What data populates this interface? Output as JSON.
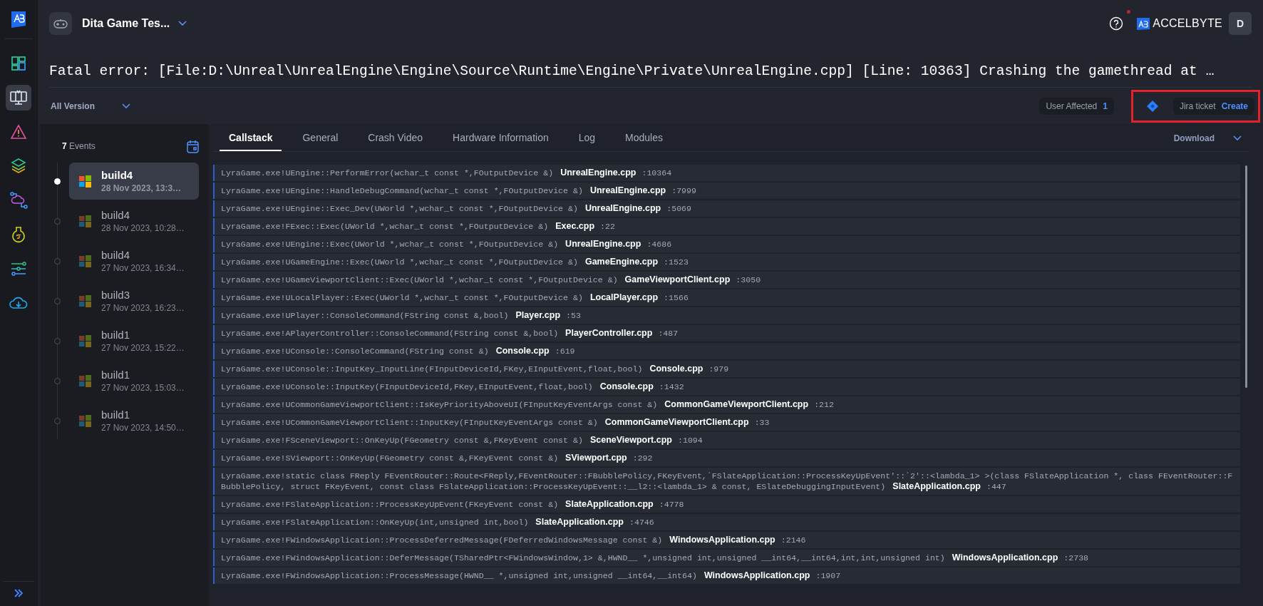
{
  "nav_items": [
    {
      "selected": false
    },
    {
      "selected": true
    },
    {
      "selected": false
    },
    {
      "selected": false
    },
    {
      "selected": false
    },
    {
      "selected": false
    },
    {
      "selected": false
    },
    {
      "selected": false
    }
  ],
  "top_bar": {
    "project": "Dita Game Tes...",
    "brand": "ACCELBYTE",
    "avatar": "D",
    "notification": true
  },
  "title": "Fatal error: [File:D:\\Unreal\\UnrealEngine\\Engine\\Source\\Runtime\\Engine\\Private\\UnrealEngine.cpp] [Line: 10363] Crashing the gamethread at …",
  "filter": {
    "version": "All Version"
  },
  "user_affected": {
    "label": "User Affected",
    "count": "1"
  },
  "jira": {
    "label": "Jira ticket",
    "action": "Create",
    "highlighted": true
  },
  "events": {
    "count": "7",
    "label": "Events",
    "items": [
      {
        "build": "build4",
        "time": "28 Nov 2023, 13:3…",
        "selected": true
      },
      {
        "build": "build4",
        "time": "28 Nov 2023, 10:28…",
        "selected": false
      },
      {
        "build": "build4",
        "time": "27 Nov 2023, 16:34…",
        "selected": false
      },
      {
        "build": "build3",
        "time": "27 Nov 2023, 16:23…",
        "selected": false
      },
      {
        "build": "build1",
        "time": "27 Nov 2023, 15:22…",
        "selected": false
      },
      {
        "build": "build1",
        "time": "27 Nov 2023, 15:03…",
        "selected": false
      },
      {
        "build": "build1",
        "time": "27 Nov 2023, 14:50…",
        "selected": false
      }
    ]
  },
  "tabs": [
    {
      "label": "Callstack",
      "selected": true
    },
    {
      "label": "General",
      "selected": false
    },
    {
      "label": "Crash Video",
      "selected": false
    },
    {
      "label": "Hardware Information",
      "selected": false
    },
    {
      "label": "Log",
      "selected": false
    },
    {
      "label": "Modules",
      "selected": false
    }
  ],
  "download": "Download",
  "callstack": [
    {
      "call": "LyraGame.exe!UEngine::PerformError(wchar_t const *,FOutputDevice &)",
      "file": "UnrealEngine.cpp",
      "line": ":10364"
    },
    {
      "call": "LyraGame.exe!UEngine::HandleDebugCommand(wchar_t const *,FOutputDevice &)",
      "file": "UnrealEngine.cpp",
      "line": ":7999"
    },
    {
      "call": "LyraGame.exe!UEngine::Exec_Dev(UWorld *,wchar_t const *,FOutputDevice &)",
      "file": "UnrealEngine.cpp",
      "line": ":5069"
    },
    {
      "call": "LyraGame.exe!FExec::Exec(UWorld *,wchar_t const *,FOutputDevice &)",
      "file": "Exec.cpp",
      "line": ":22"
    },
    {
      "call": "LyraGame.exe!UEngine::Exec(UWorld *,wchar_t const *,FOutputDevice &)",
      "file": "UnrealEngine.cpp",
      "line": ":4686"
    },
    {
      "call": "LyraGame.exe!UGameEngine::Exec(UWorld *,wchar_t const *,FOutputDevice &)",
      "file": "GameEngine.cpp",
      "line": ":1523"
    },
    {
      "call": "LyraGame.exe!UGameViewportClient::Exec(UWorld *,wchar_t const *,FOutputDevice &)",
      "file": "GameViewportClient.cpp",
      "line": ":3050"
    },
    {
      "call": "LyraGame.exe!ULocalPlayer::Exec(UWorld *,wchar_t const *,FOutputDevice &)",
      "file": "LocalPlayer.cpp",
      "line": ":1566"
    },
    {
      "call": "LyraGame.exe!UPlayer::ConsoleCommand(FString const &,bool)",
      "file": "Player.cpp",
      "line": ":53"
    },
    {
      "call": "LyraGame.exe!APlayerController::ConsoleCommand(FString const &,bool)",
      "file": "PlayerController.cpp",
      "line": ":487"
    },
    {
      "call": "LyraGame.exe!UConsole::ConsoleCommand(FString const &)",
      "file": "Console.cpp",
      "line": ":619"
    },
    {
      "call": "LyraGame.exe!UConsole::InputKey_InputLine(FInputDeviceId,FKey,EInputEvent,float,bool)",
      "file": "Console.cpp",
      "line": ":979"
    },
    {
      "call": "LyraGame.exe!UConsole::InputKey(FInputDeviceId,FKey,EInputEvent,float,bool)",
      "file": "Console.cpp",
      "line": ":1432"
    },
    {
      "call": "LyraGame.exe!UCommonGameViewportClient::IsKeyPriorityAboveUI(FInputKeyEventArgs const &)",
      "file": "CommonGameViewportClient.cpp",
      "line": ":212"
    },
    {
      "call": "LyraGame.exe!UCommonGameViewportClient::InputKey(FInputKeyEventArgs const &)",
      "file": "CommonGameViewportClient.cpp",
      "line": ":33"
    },
    {
      "call": "LyraGame.exe!FSceneViewport::OnKeyUp(FGeometry const &,FKeyEvent const &)",
      "file": "SceneViewport.cpp",
      "line": ":1094"
    },
    {
      "call": "LyraGame.exe!SViewport::OnKeyUp(FGeometry const &,FKeyEvent const &)",
      "file": "SViewport.cpp",
      "line": ":292"
    },
    {
      "call": "LyraGame.exe!static class FReply FEventRouter::Route<FReply,FEventRouter::FBubblePolicy,FKeyEvent,`FSlateApplication::ProcessKeyUpEvent'::`2'::<lambda_1> >(class FSlateApplication *, class FEventRouter::FBubblePolicy, struct FKeyEvent, const class FSlateApplication::ProcessKeyUpEvent::__l2::<lambda_1> & const, ESlateDebuggingInputEvent)",
      "file": "SlateApplication.cpp",
      "line": ":447"
    },
    {
      "call": "LyraGame.exe!FSlateApplication::ProcessKeyUpEvent(FKeyEvent const &)",
      "file": "SlateApplication.cpp",
      "line": ":4778"
    },
    {
      "call": "LyraGame.exe!FSlateApplication::OnKeyUp(int,unsigned int,bool)",
      "file": "SlateApplication.cpp",
      "line": ":4746"
    },
    {
      "call": "LyraGame.exe!FWindowsApplication::ProcessDeferredMessage(FDeferredWindowsMessage const &)",
      "file": "WindowsApplication.cpp",
      "line": ":2146"
    },
    {
      "call": "LyraGame.exe!FWindowsApplication::DeferMessage(TSharedPtr<FWindowsWindow,1> &,HWND__ *,unsigned int,unsigned __int64,__int64,int,int,unsigned int)",
      "file": "WindowsApplication.cpp",
      "line": ":2738"
    },
    {
      "call": "LyraGame.exe!FWindowsApplication::ProcessMessage(HWND__ *,unsigned int,unsigned __int64,__int64)",
      "file": "WindowsApplication.cpp",
      "line": ":1907"
    }
  ]
}
